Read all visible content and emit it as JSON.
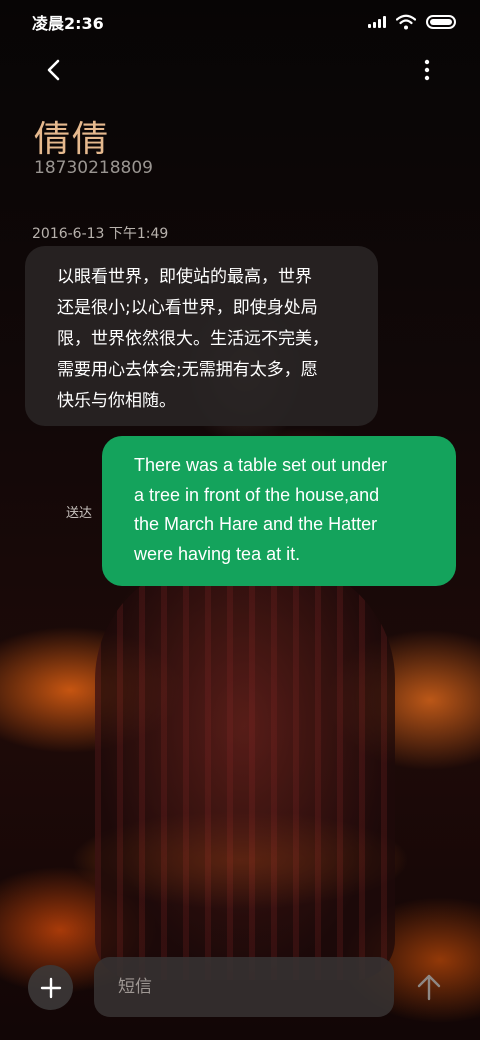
{
  "status_bar": {
    "time": "凌晨2:36",
    "icons": [
      "signal-icon",
      "wifi-icon",
      "battery-icon"
    ]
  },
  "header": {
    "back_icon": "chevron-left-icon",
    "more_icon": "more-vertical-icon",
    "contact_name": "倩倩",
    "contact_number": "18730218809"
  },
  "conversation": {
    "timestamp": "2016-6-13 下午1:49",
    "incoming": {
      "lines": [
        "以眼看世界，即使站的最高，世界",
        "还是很小;以心看世界，即使身处局",
        "限，世界依然很大。生活远不完美，",
        "需要用心去体会;无需拥有太多，愿",
        "快乐与你相随。"
      ]
    },
    "outgoing": {
      "lines": [
        "There was a table set out under",
        "a tree in front of the house,and",
        "the March Hare and the Hatter",
        "were having tea at it."
      ],
      "status": "送达"
    }
  },
  "composer": {
    "add_icon": "plus-icon",
    "placeholder": "短信",
    "value": "",
    "send_icon": "arrow-up-icon"
  },
  "colors": {
    "outgoing_bubble": "#14a35c",
    "incoming_bubble": "#282424",
    "contact_name": "#e6b98e"
  }
}
